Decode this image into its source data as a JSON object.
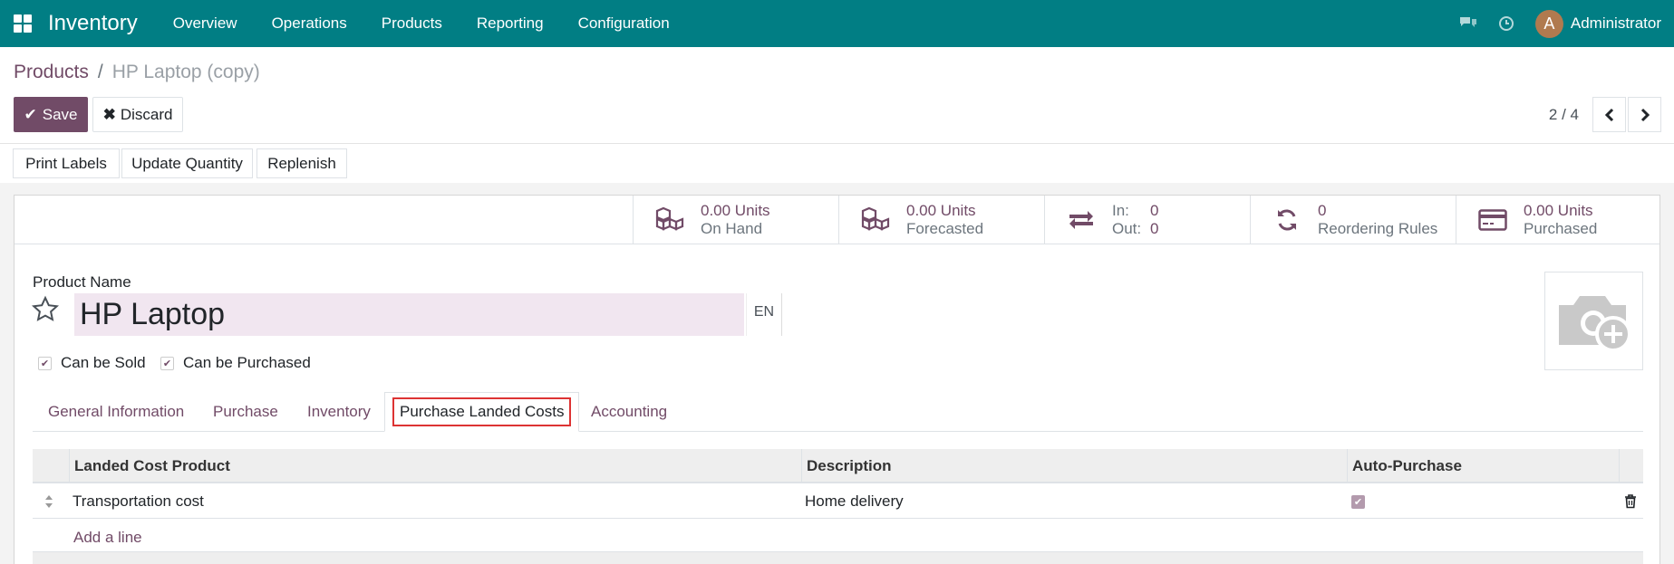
{
  "navbar": {
    "brand": "Inventory",
    "menu": [
      "Overview",
      "Operations",
      "Products",
      "Reporting",
      "Configuration"
    ],
    "user_initial": "A",
    "user_name": "Administrator",
    "bg_color": "#017e84"
  },
  "breadcrumb": {
    "parent": "Products",
    "separator": "/",
    "current": "HP Laptop (copy)"
  },
  "buttons": {
    "save": "Save",
    "discard": "Discard"
  },
  "pager": {
    "value": "2 / 4"
  },
  "actions": [
    "Print Labels",
    "Update Quantity",
    "Replenish"
  ],
  "stats": {
    "on_hand": {
      "value": "0.00 Units",
      "label": "On Hand",
      "icon": "cubes-icon"
    },
    "forecasted": {
      "value": "0.00 Units",
      "label": "Forecasted",
      "icon": "cubes-icon"
    },
    "in_out": {
      "in_label": "In:",
      "in_value": "0",
      "out_label": "Out:",
      "out_value": "0",
      "icon": "exchange-icon"
    },
    "reordering": {
      "value": "0",
      "label": "Reordering Rules",
      "icon": "refresh-icon"
    },
    "purchased": {
      "value": "0.00 Units",
      "label": "Purchased",
      "icon": "credit-card-icon"
    }
  },
  "form": {
    "product_name_label": "Product Name",
    "product_name": "HP Laptop",
    "lang": "EN",
    "can_be_sold": "Can be Sold",
    "can_be_purchased": "Can be Purchased"
  },
  "tabs": [
    "General Information",
    "Purchase",
    "Inventory",
    "Purchase Landed Costs",
    "Accounting"
  ],
  "active_tab": "Purchase Landed Costs",
  "table": {
    "headers": [
      "Landed Cost Product",
      "Description",
      "Auto-Purchase"
    ],
    "rows": [
      {
        "product": "Transportation cost",
        "description": "Home delivery",
        "auto_purchase": true
      }
    ],
    "add_line": "Add a line"
  },
  "colors": {
    "accent": "#714b67",
    "highlight": "#dd3333"
  }
}
